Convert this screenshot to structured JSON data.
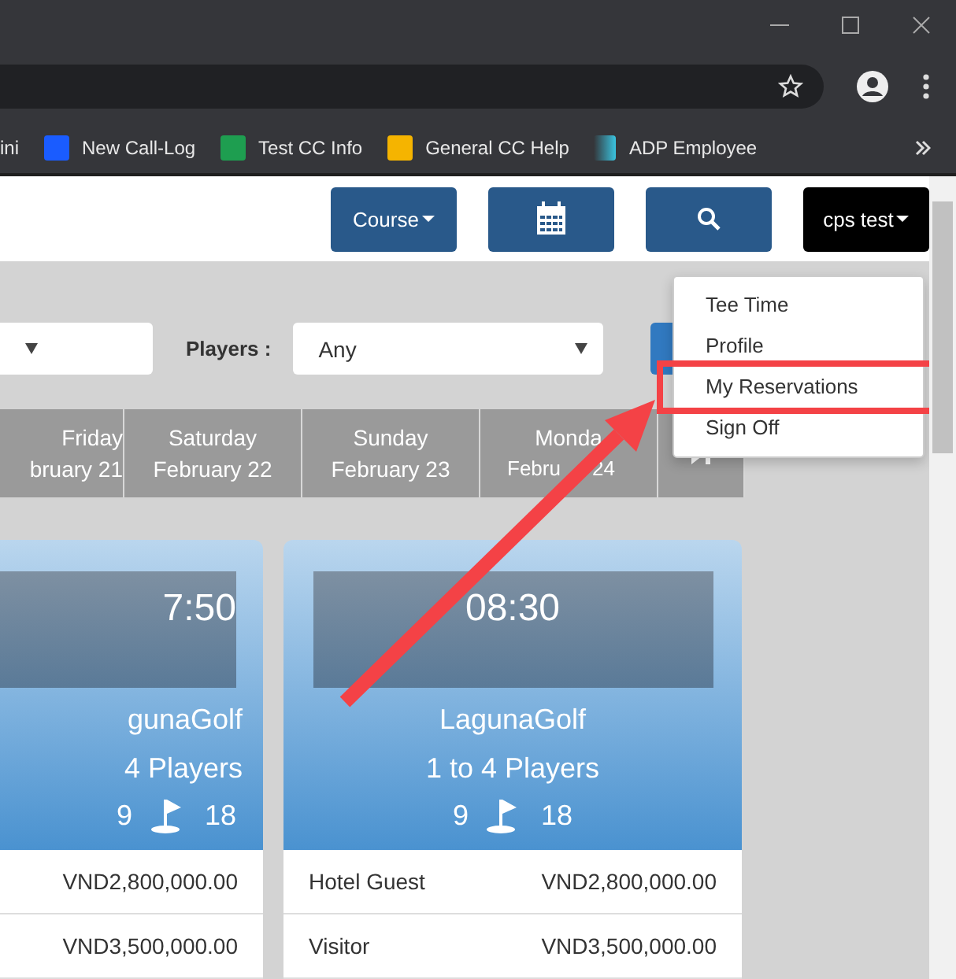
{
  "bookmarks": [
    {
      "label": "ini"
    },
    {
      "label": "New Call-Log"
    },
    {
      "label": "Test CC Info"
    },
    {
      "label": "General CC Help"
    },
    {
      "label": "ADP Employee"
    }
  ],
  "nav": {
    "course": "Course",
    "user": "cps test"
  },
  "menu": [
    {
      "label": "Tee Time",
      "highlighted": false
    },
    {
      "label": "Profile",
      "highlighted": false
    },
    {
      "label": "My Reservations",
      "highlighted": true
    },
    {
      "label": "Sign Off",
      "highlighted": false
    }
  ],
  "filters": {
    "players_label": "Players :",
    "players_value": "Any"
  },
  "dates": [
    {
      "day": "Friday",
      "date": "bruary 21"
    },
    {
      "day": "Saturday",
      "date": "February 22"
    },
    {
      "day": "Sunday",
      "date": "February 23"
    },
    {
      "day": "Monda",
      "date": "Febru",
      "date_end": "24"
    }
  ],
  "cards": [
    {
      "time": "7:50",
      "course": "gunaGolf",
      "players": "4 Players",
      "holes_a": "9",
      "holes_b": "18",
      "rates": [
        {
          "price": "VND2,800,000.00"
        },
        {
          "price": "VND3,500,000.00"
        }
      ]
    },
    {
      "time": "08:30",
      "course": "LagunaGolf",
      "players": "1 to 4 Players",
      "holes_a": "9",
      "holes_b": "18",
      "rates": [
        {
          "name": "Hotel Guest",
          "price": "VND2,800,000.00"
        },
        {
          "name": "Visitor",
          "price": "VND3,500,000.00"
        }
      ]
    }
  ]
}
